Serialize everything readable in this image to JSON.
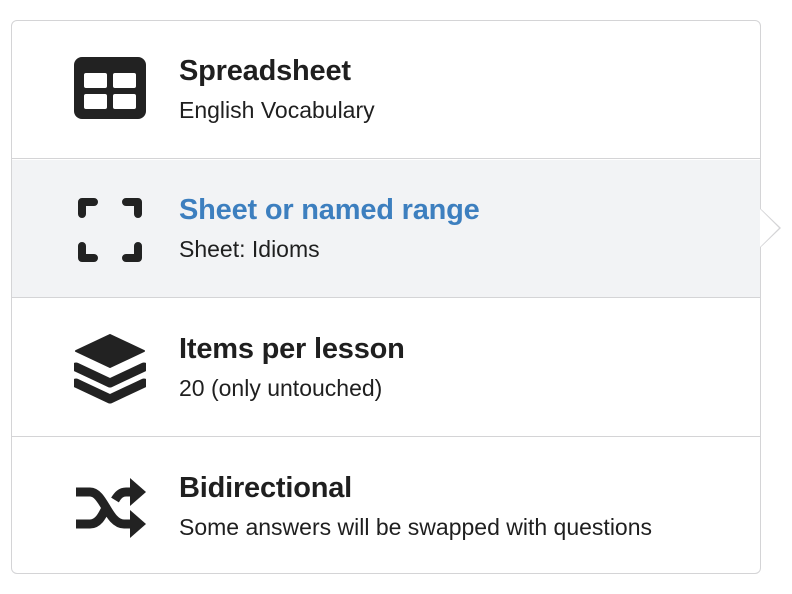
{
  "menu": {
    "items": [
      {
        "icon": "table-icon",
        "title": "Spreadsheet",
        "subtitle": "English Vocabulary",
        "active": false
      },
      {
        "icon": "range-select-icon",
        "title": "Sheet or named range",
        "subtitle": "Sheet: Idioms",
        "active": true
      },
      {
        "icon": "layers-icon",
        "title": "Items per lesson",
        "subtitle": "20 (only untouched)",
        "active": false
      },
      {
        "icon": "shuffle-icon",
        "title": "Bidirectional",
        "subtitle": "Some answers will be swapped with questions",
        "active": false
      }
    ]
  },
  "colors": {
    "active_title": "#3d7fbf",
    "active_background": "#f2f3f5",
    "text": "#1f1f1f",
    "border": "#d4d4d6",
    "icon": "#222222"
  }
}
